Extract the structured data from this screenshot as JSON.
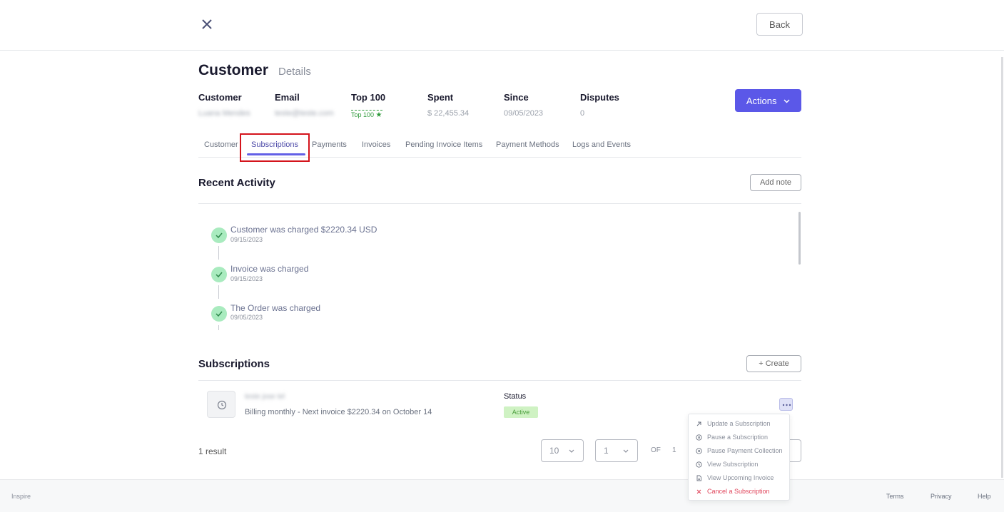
{
  "header": {
    "back_label": "Back"
  },
  "page": {
    "title": "Customer",
    "subtitle": "Details"
  },
  "info": {
    "columns": [
      {
        "label": "Customer",
        "value": "Luana Mendes"
      },
      {
        "label": "Email",
        "value": "teste@teste.com"
      },
      {
        "label": "Top 100",
        "value": "Top 100"
      },
      {
        "label": "Spent",
        "value": "$ 22,455.34"
      },
      {
        "label": "Since",
        "value": "09/05/2023"
      },
      {
        "label": "Disputes",
        "value": "0"
      }
    ],
    "top100_star": "★"
  },
  "actions": {
    "label": "Actions"
  },
  "tabs": [
    {
      "label": "Customer"
    },
    {
      "label": "Subscriptions",
      "active": true
    },
    {
      "label": "Payments"
    },
    {
      "label": "Invoices"
    },
    {
      "label": "Pending Invoice Items"
    },
    {
      "label": "Payment Methods"
    },
    {
      "label": "Logs and Events"
    }
  ],
  "recent_activity": {
    "title": "Recent Activity",
    "add_note_label": "Add note",
    "items": [
      {
        "text": "Customer was charged $2220.34 USD",
        "date": "09/15/2023"
      },
      {
        "text": "Invoice was charged",
        "date": "09/15/2023"
      },
      {
        "text": "The Order was charged",
        "date": "09/05/2023"
      }
    ]
  },
  "subscriptions": {
    "title": "Subscriptions",
    "create_label": "+ Create",
    "item": {
      "name": "teste jose tel",
      "billing": "Billing monthly - Next invoice $2220.34 on October 14",
      "status_label": "Status",
      "status": "Active"
    },
    "menu": [
      {
        "label": "Update a Subscription",
        "icon": "arrow-up-right-icon"
      },
      {
        "label": "Pause a Subscription",
        "icon": "pause-circle-icon"
      },
      {
        "label": "Pause Payment Collection",
        "icon": "pause-circle-icon"
      },
      {
        "label": "View Subscription",
        "icon": "clock-icon"
      },
      {
        "label": "View Upcoming Invoice",
        "icon": "document-icon"
      },
      {
        "label": "Cancel a Subscription",
        "icon": "x-icon",
        "danger": true
      }
    ],
    "result_count": "1 result",
    "page_size": "10",
    "page": "1",
    "of_label": "OF",
    "total_pages": "1"
  },
  "footer": {
    "brand": "Inspire",
    "links": [
      "Terms",
      "Privacy",
      "Help"
    ]
  },
  "colors": {
    "accent": "#5b58e8",
    "success": "#a9ebbf",
    "danger": "#e0445a",
    "highlight": "#d4141c"
  }
}
